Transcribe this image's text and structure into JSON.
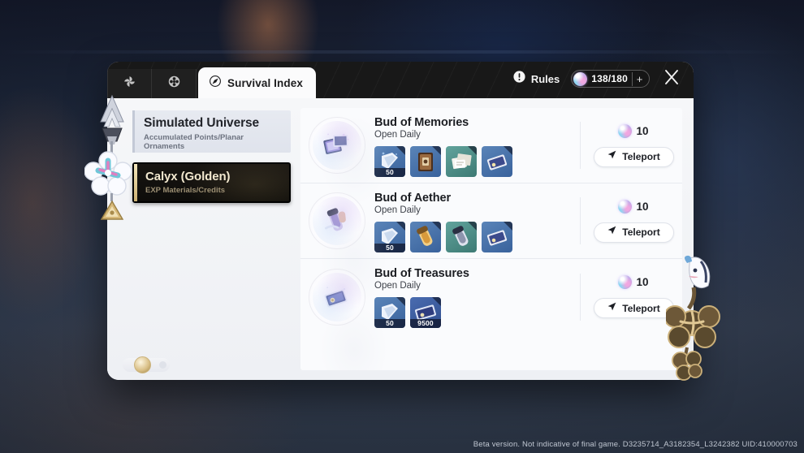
{
  "window": {
    "tabs_left": [
      {
        "name": "tab-pinwheel",
        "icon": "pinwheel-icon"
      },
      {
        "name": "tab-flower",
        "icon": "flower-icon"
      }
    ],
    "active_tab": {
      "label": "Survival Index",
      "icon": "compass-icon"
    },
    "rules": {
      "label": "Rules",
      "icon": "exclamation-icon"
    },
    "currency": {
      "icon": "trailblaze-power-orb",
      "value": "138/180",
      "plus": "+"
    },
    "close": {
      "icon": "close-icon"
    }
  },
  "sidebar": {
    "items": [
      {
        "title": "Simulated Universe",
        "subtitle": "Accumulated Points/Planar Ornaments",
        "active": false
      },
      {
        "title": "Calyx (Golden)",
        "subtitle": "EXP Materials/Credits",
        "active": true
      }
    ],
    "badge": {
      "name": "seal-badge"
    }
  },
  "content": {
    "rows": [
      {
        "title": "Bud of Memories",
        "subtitle": "Open Daily",
        "emblem": "bud-of-memories-emblem",
        "cost": {
          "icon": "trailblaze-power-orb",
          "value": "10"
        },
        "teleport": {
          "label": "Teleport",
          "icon": "teleport-arrow-icon"
        },
        "rewards": [
          {
            "name": "reward-traveler-guide",
            "qty": "50",
            "bg": "#41689f",
            "art": "book-white"
          },
          {
            "name": "reward-adventure-log",
            "qty": "",
            "bg": "#4470a6",
            "art": "book-brown"
          },
          {
            "name": "reward-travel-encounters",
            "qty": "",
            "bg": "#4a8a84",
            "art": "papers"
          },
          {
            "name": "reward-calyx-ticket",
            "qty": "",
            "bg": "#4470a6",
            "art": "card-purple"
          }
        ]
      },
      {
        "title": "Bud of Aether",
        "subtitle": "Open Daily",
        "emblem": "bud-of-aether-emblem",
        "cost": {
          "icon": "trailblaze-power-orb",
          "value": "10"
        },
        "teleport": {
          "label": "Teleport",
          "icon": "teleport-arrow-icon"
        },
        "rewards": [
          {
            "name": "reward-traveler-guide",
            "qty": "50",
            "bg": "#41689f",
            "art": "book-white"
          },
          {
            "name": "reward-gold-vial",
            "qty": "",
            "bg": "#4470a6",
            "art": "vial-gold"
          },
          {
            "name": "reward-silver-vial",
            "qty": "",
            "bg": "#4a8a84",
            "art": "vial-silver"
          },
          {
            "name": "reward-calyx-ticket",
            "qty": "",
            "bg": "#4470a6",
            "art": "card-purple"
          }
        ]
      },
      {
        "title": "Bud of Treasures",
        "subtitle": "Open Daily",
        "emblem": "bud-of-treasures-emblem",
        "cost": {
          "icon": "trailblaze-power-orb",
          "value": "10"
        },
        "teleport": {
          "label": "Teleport",
          "icon": "teleport-arrow-icon"
        },
        "rewards": [
          {
            "name": "reward-traveler-guide",
            "qty": "50",
            "bg": "#41689f",
            "art": "book-white"
          },
          {
            "name": "reward-credit-card",
            "qty": "9500",
            "bg": "#3c5ea0",
            "art": "card-blue"
          }
        ]
      }
    ]
  },
  "decorations": {
    "left": "charm-keychain-left",
    "right": "flower-ornament-right"
  },
  "footer": {
    "text": "Beta version. Not indicative of final game. D3235714_A3182354_L3242382  UID:410000703"
  }
}
